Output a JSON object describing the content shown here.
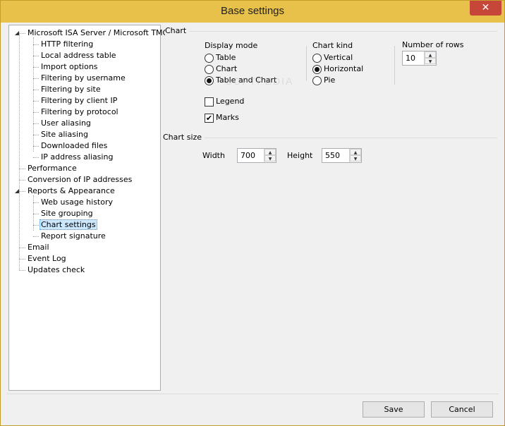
{
  "window": {
    "title": "Base settings",
    "close_glyph": "✕"
  },
  "tree": {
    "items": [
      {
        "label": "Microsoft ISA Server / Microsoft TMG",
        "level": 0,
        "expanded": true
      },
      {
        "label": "HTTP filtering",
        "level": 1
      },
      {
        "label": "Local address table",
        "level": 1
      },
      {
        "label": "Import options",
        "level": 1
      },
      {
        "label": "Filtering by username",
        "level": 1
      },
      {
        "label": "Filtering by site",
        "level": 1
      },
      {
        "label": "Filtering by client IP",
        "level": 1
      },
      {
        "label": "Filtering by protocol",
        "level": 1
      },
      {
        "label": "User aliasing",
        "level": 1
      },
      {
        "label": "Site aliasing",
        "level": 1
      },
      {
        "label": "Downloaded files",
        "level": 1
      },
      {
        "label": "IP address aliasing",
        "level": 1
      },
      {
        "label": "Performance",
        "level": 0
      },
      {
        "label": "Conversion of IP addresses",
        "level": 0
      },
      {
        "label": "Reports & Appearance",
        "level": 0,
        "expanded": true
      },
      {
        "label": "Web usage history",
        "level": 1
      },
      {
        "label": "Site grouping",
        "level": 1
      },
      {
        "label": "Chart settings",
        "level": 1,
        "selected": true
      },
      {
        "label": "Report signature",
        "level": 1
      },
      {
        "label": "Email",
        "level": 0
      },
      {
        "label": "Event Log",
        "level": 0
      },
      {
        "label": "Updates check",
        "level": 0
      }
    ]
  },
  "chart_group": {
    "title": "Chart",
    "display_mode": {
      "label": "Display mode",
      "options": [
        "Table",
        "Chart",
        "Table and Chart"
      ],
      "selected": "Table and Chart"
    },
    "chart_kind": {
      "label": "Chart kind",
      "options": [
        "Vertical",
        "Horizontal",
        "Pie"
      ],
      "selected": "Horizontal"
    },
    "rows": {
      "label": "Number of rows",
      "value": "10"
    },
    "legend": {
      "label": "Legend",
      "checked": false
    },
    "marks": {
      "label": "Marks",
      "checked": true
    }
  },
  "chart_size": {
    "title": "Chart size",
    "width_label": "Width",
    "width_value": "700",
    "height_label": "Height",
    "height_value": "550"
  },
  "buttons": {
    "save": "Save",
    "cancel": "Cancel"
  },
  "watermark": "SOFTPEDIA",
  "colors": {
    "titlebar": "#e8c14b",
    "close": "#c7463a",
    "selection": "#cce8ff"
  }
}
